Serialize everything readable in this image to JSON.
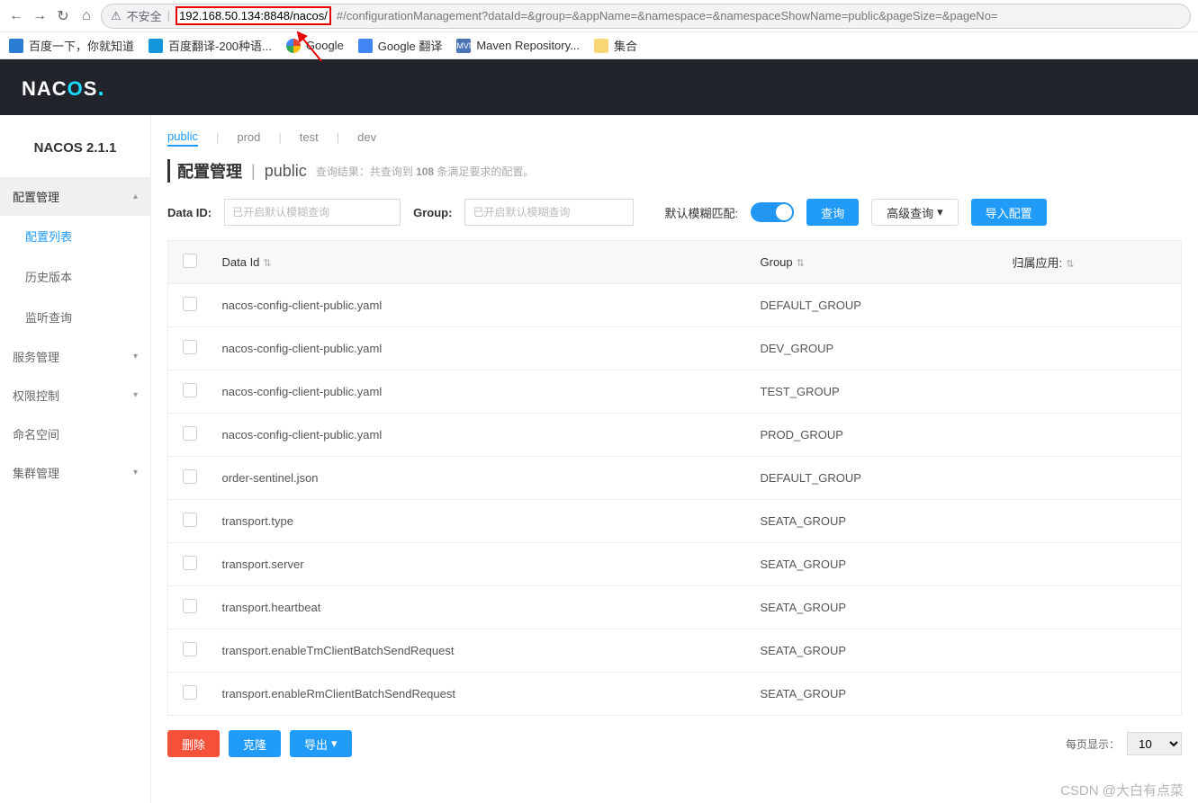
{
  "browser": {
    "insecure_label": "不安全",
    "url_highlight": "192.168.50.134:8848/nacos/",
    "url_rest": "#/configurationManagement?dataId=&group=&appName=&namespace=&namespaceShowName=public&pageSize=&pageNo="
  },
  "bookmarks": [
    {
      "label": "百度一下，你就知道"
    },
    {
      "label": "百度翻译-200种语..."
    },
    {
      "label": "Google"
    },
    {
      "label": "Google 翻译"
    },
    {
      "label": "Maven Repository..."
    },
    {
      "label": "集合"
    }
  ],
  "header": {
    "logo_text": "NACOS."
  },
  "sidebar": {
    "version": "NACOS 2.1.1",
    "groups": [
      {
        "label": "配置管理",
        "open": true,
        "items": [
          {
            "label": "配置列表",
            "active": true
          },
          {
            "label": "历史版本"
          },
          {
            "label": "监听查询"
          }
        ]
      },
      {
        "label": "服务管理"
      },
      {
        "label": "权限控制"
      },
      {
        "label": "命名空间"
      },
      {
        "label": "集群管理"
      }
    ]
  },
  "namespaces": {
    "tabs": [
      {
        "label": "public",
        "active": true
      },
      {
        "label": "prod"
      },
      {
        "label": "test"
      },
      {
        "label": "dev"
      }
    ]
  },
  "page": {
    "title": "配置管理",
    "ns": "public",
    "result_prefix": "查询结果：共查询到 ",
    "result_count": "108",
    "result_suffix": " 条满足要求的配置。"
  },
  "filter": {
    "data_id_label": "Data ID:",
    "data_id_placeholder": "已开启默认模糊查询",
    "group_label": "Group:",
    "group_placeholder": "已开启默认模糊查询",
    "fuzzy_label": "默认模糊匹配:",
    "search_btn": "查询",
    "adv_btn": "高级查询",
    "import_btn": "导入配置"
  },
  "table": {
    "col_dataid": "Data Id",
    "col_group": "Group",
    "col_app": "归属应用:",
    "rows": [
      {
        "dataId": "nacos-config-client-public.yaml",
        "group": "DEFAULT_GROUP"
      },
      {
        "dataId": "nacos-config-client-public.yaml",
        "group": "DEV_GROUP"
      },
      {
        "dataId": "nacos-config-client-public.yaml",
        "group": "TEST_GROUP"
      },
      {
        "dataId": "nacos-config-client-public.yaml",
        "group": "PROD_GROUP"
      },
      {
        "dataId": "order-sentinel.json",
        "group": "DEFAULT_GROUP"
      },
      {
        "dataId": "transport.type",
        "group": "SEATA_GROUP"
      },
      {
        "dataId": "transport.server",
        "group": "SEATA_GROUP"
      },
      {
        "dataId": "transport.heartbeat",
        "group": "SEATA_GROUP"
      },
      {
        "dataId": "transport.enableTmClientBatchSendRequest",
        "group": "SEATA_GROUP"
      },
      {
        "dataId": "transport.enableRmClientBatchSendRequest",
        "group": "SEATA_GROUP"
      }
    ]
  },
  "actions": {
    "delete": "删除",
    "clone": "克隆",
    "export": "导出"
  },
  "pagination": {
    "label": "每页显示：",
    "size": "10"
  },
  "watermark": "CSDN @大白有点菜"
}
